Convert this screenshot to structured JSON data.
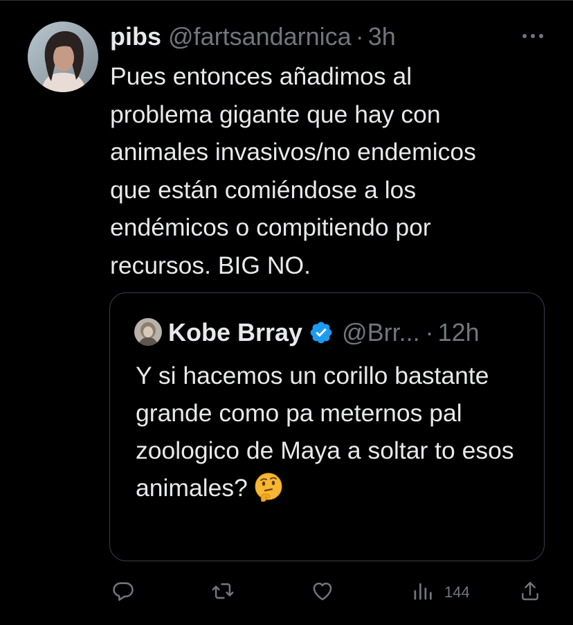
{
  "tweet": {
    "display_name": "pibs",
    "handle": "@fartsandarnica",
    "separator": "·",
    "time": "3h",
    "text": "Pues entonces añadimos al\nproblema gigante que hay con\nanimales invasivos/no endemicos\nque están comiéndose a los\nendémicos o compitiendo por\nrecursos. BIG NO."
  },
  "quote": {
    "display_name": "Kobe Brray",
    "handle": "@Brr...",
    "separator": "·",
    "time": "12h",
    "text": "Y si hacemos un corillo bastante grande como pa meternos pal zoologico de Maya a soltar to esos animales?",
    "emoji": "thinking-face"
  },
  "actions": {
    "views": "144",
    "icons": [
      "reply-icon",
      "retweet-icon",
      "like-icon",
      "views-icon",
      "share-icon"
    ]
  },
  "colors": {
    "background": "#000000",
    "text": "#e7e9ea",
    "secondary": "#71767b",
    "border": "#3a3f44",
    "verified": "#1d9bf0"
  }
}
